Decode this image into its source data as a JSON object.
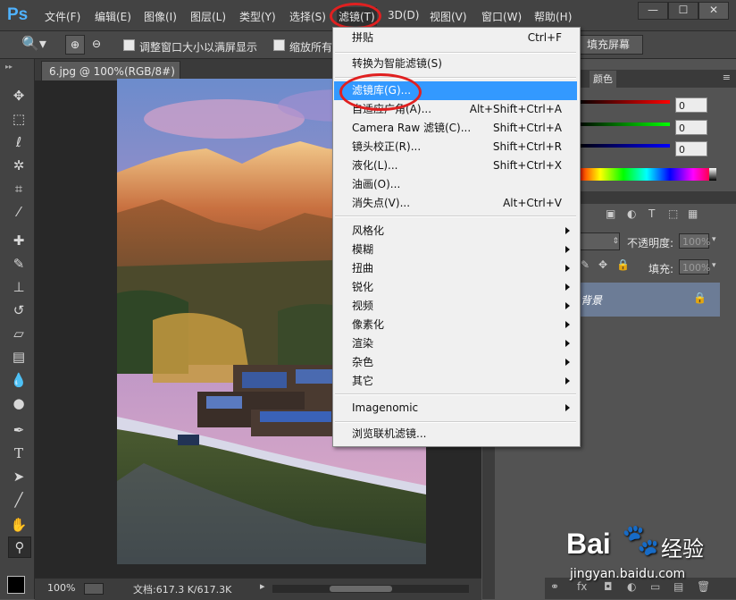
{
  "app": {
    "logo": "Ps"
  },
  "menubar": {
    "items": [
      {
        "label": "文件(F)"
      },
      {
        "label": "编辑(E)"
      },
      {
        "label": "图像(I)"
      },
      {
        "label": "图层(L)"
      },
      {
        "label": "类型(Y)"
      },
      {
        "label": "选择(S)"
      },
      {
        "label": "滤镜(T)"
      },
      {
        "label": "3D(D)"
      },
      {
        "label": "视图(V)"
      },
      {
        "label": "窗口(W)"
      },
      {
        "label": "帮助(H)"
      }
    ],
    "window_controls": [
      "—",
      "☐",
      "✕"
    ]
  },
  "options_bar": {
    "checkbox1_label": "调整窗口大小以满屏显示",
    "checkbox2_label": "缩放所有",
    "fill_screen_button": "填充屏幕"
  },
  "document": {
    "tab_label": "6.jpg @ 100%(RGB/8#)",
    "zoom": "100%",
    "doc_info": "文档:617.3 K/617.3K"
  },
  "panels": {
    "color_tab": "颜色",
    "rgb_values": [
      "0",
      "0",
      "0"
    ],
    "opacity_label": "不透明度:",
    "opacity_value": "100%",
    "fill_label": "填充:",
    "fill_value": "100%",
    "layer_name": "背景"
  },
  "filter_menu": {
    "items": [
      {
        "label": "拼贴",
        "shortcut": "Ctrl+F"
      },
      {
        "label": "转换为智能滤镜(S)",
        "shortcut": ""
      },
      {
        "label": "滤镜库(G)...",
        "shortcut": "",
        "highlighted": true
      },
      {
        "label": "自适应广角(A)...",
        "shortcut": "Alt+Shift+Ctrl+A"
      },
      {
        "label": "Camera Raw 滤镜(C)...",
        "shortcut": "Shift+Ctrl+A"
      },
      {
        "label": "镜头校正(R)...",
        "shortcut": "Shift+Ctrl+R"
      },
      {
        "label": "液化(L)...",
        "shortcut": "Shift+Ctrl+X"
      },
      {
        "label": "油画(O)...",
        "shortcut": ""
      },
      {
        "label": "消失点(V)...",
        "shortcut": "Alt+Ctrl+V"
      },
      {
        "label": "风格化",
        "submenu": true
      },
      {
        "label": "模糊",
        "submenu": true
      },
      {
        "label": "扭曲",
        "submenu": true
      },
      {
        "label": "锐化",
        "submenu": true
      },
      {
        "label": "视频",
        "submenu": true
      },
      {
        "label": "像素化",
        "submenu": true
      },
      {
        "label": "渲染",
        "submenu": true
      },
      {
        "label": "杂色",
        "submenu": true
      },
      {
        "label": "其它",
        "submenu": true
      },
      {
        "label": "Imagenomic",
        "submenu": true
      },
      {
        "label": "浏览联机滤镜..."
      }
    ]
  },
  "watermark": {
    "brand": "Bai",
    "brand2": "经验",
    "url": "jingyan.baidu.com"
  },
  "colors": {
    "highlight": "#3399ff",
    "annotation_red": "#e02020",
    "ps_blue": "#4fb2ff"
  }
}
